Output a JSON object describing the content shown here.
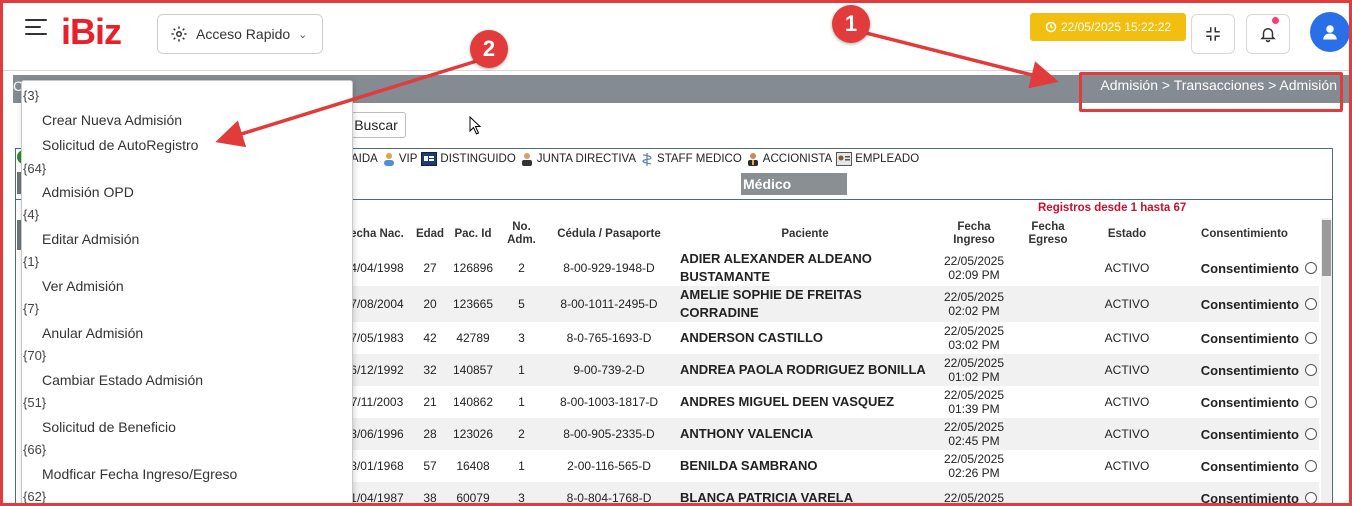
{
  "header": {
    "logo": "iBiz",
    "quick_access_label": "Acceso Rapido",
    "clock": "22/05/2025 15:22:22"
  },
  "breadcrumb": {
    "lead": "C",
    "path": "Admisión > Transacciones > Admisión"
  },
  "search_button": "Buscar",
  "annotations": {
    "badge1": "1",
    "badge2": "2"
  },
  "menu": {
    "entries": [
      {
        "code": "{3}",
        "label": "Crear Nueva Admisión"
      },
      {
        "code": "",
        "label": "Solicitud de AutoRegistro"
      },
      {
        "code": "{64}",
        "label": "Admisión OPD"
      },
      {
        "code": "{4}",
        "label": "Editar Admisión"
      },
      {
        "code": "{1}",
        "label": "Ver Admisión"
      },
      {
        "code": "{7}",
        "label": "Anular Admisión"
      },
      {
        "code": "{70}",
        "label": "Cambiar Estado Admisión"
      },
      {
        "code": "{51}",
        "label": "Solicitud de Beneficio"
      },
      {
        "code": "{66}",
        "label": "Modficar Fecha Ingreso/Egreso"
      },
      {
        "code": "{62}",
        "label": ""
      }
    ]
  },
  "legend": [
    {
      "label": "AIDA",
      "icon": "caida-icon"
    },
    {
      "label": "VIP",
      "icon": "vip-icon"
    },
    {
      "label": "DISTINGUIDO",
      "icon": "distinguished-icon"
    },
    {
      "label": "JUNTA DIRECTIVA",
      "icon": "board-icon"
    },
    {
      "label": "STAFF MEDICO",
      "icon": "caduceus-icon"
    },
    {
      "label": "ACCIONISTA",
      "icon": "shareholder-icon"
    },
    {
      "label": "EMPLEADO",
      "icon": "employee-icon"
    }
  ],
  "section_title": "Médico",
  "records_label": "Registros desde 1 hasta 67",
  "table": {
    "columns": [
      "echa Nac.",
      "Edad",
      "Pac. Id",
      "No. Adm.",
      "Cédula / Pasaporte",
      "Paciente",
      "Fecha Ingreso",
      "Fecha Egreso",
      "Estado",
      "Consentimiento"
    ],
    "rows": [
      {
        "fecha_nac": "4/04/1998",
        "edad": "27",
        "pac_id": "126896",
        "no_adm": "2",
        "cedula": "8-00-929-1948-D",
        "paciente": "ADIER ALEXANDER ALDEANO BUSTAMANTE",
        "ingreso_fecha": "22/05/2025",
        "ingreso_hora": "02:09 PM",
        "egreso": "",
        "estado": "ACTIVO",
        "consent": "Consentimiento"
      },
      {
        "fecha_nac": "7/08/2004",
        "edad": "20",
        "pac_id": "123665",
        "no_adm": "5",
        "cedula": "8-00-1011-2495-D",
        "paciente": "AMELIE SOPHIE DE FREITAS CORRADINE",
        "ingreso_fecha": "22/05/2025",
        "ingreso_hora": "02:02 PM",
        "egreso": "",
        "estado": "ACTIVO",
        "consent": "Consentimiento"
      },
      {
        "fecha_nac": "7/05/1983",
        "edad": "42",
        "pac_id": "42789",
        "no_adm": "3",
        "cedula": "8-0-765-1693-D",
        "paciente": "ANDERSON CASTILLO",
        "ingreso_fecha": "22/05/2025",
        "ingreso_hora": "03:02 PM",
        "egreso": "",
        "estado": "ACTIVO",
        "consent": "Consentimiento"
      },
      {
        "fecha_nac": "6/12/1992",
        "edad": "32",
        "pac_id": "140857",
        "no_adm": "1",
        "cedula": "9-00-739-2-D",
        "paciente": "ANDREA PAOLA RODRIGUEZ BONILLA",
        "ingreso_fecha": "22/05/2025",
        "ingreso_hora": "01:02 PM",
        "egreso": "",
        "estado": "ACTIVO",
        "consent": "Consentimiento"
      },
      {
        "fecha_nac": "7/11/2003",
        "edad": "21",
        "pac_id": "140862",
        "no_adm": "1",
        "cedula": "8-00-1003-1817-D",
        "paciente": "ANDRES MIGUEL DEEN VASQUEZ",
        "ingreso_fecha": "22/05/2025",
        "ingreso_hora": "01:39 PM",
        "egreso": "",
        "estado": "ACTIVO",
        "consent": "Consentimiento"
      },
      {
        "fecha_nac": "3/06/1996",
        "edad": "28",
        "pac_id": "123026",
        "no_adm": "2",
        "cedula": "8-00-905-2335-D",
        "paciente": "ANTHONY VALENCIA",
        "ingreso_fecha": "22/05/2025",
        "ingreso_hora": "02:45 PM",
        "egreso": "",
        "estado": "ACTIVO",
        "consent": "Consentimiento"
      },
      {
        "fecha_nac": "3/01/1968",
        "edad": "57",
        "pac_id": "16408",
        "no_adm": "1",
        "cedula": "2-00-116-565-D",
        "paciente": "BENILDA SAMBRANO",
        "ingreso_fecha": "22/05/2025",
        "ingreso_hora": "02:26 PM",
        "egreso": "",
        "estado": "ACTIVO",
        "consent": "Consentimiento"
      },
      {
        "fecha_nac": "1/04/1987",
        "edad": "38",
        "pac_id": "60079",
        "no_adm": "3",
        "cedula": "8-0-804-1768-D",
        "paciente": "BLANCA PATRICIA VARELA",
        "ingreso_fecha": "22/05/2025",
        "ingreso_hora": "",
        "egreso": "",
        "estado": "",
        "consent": "Consentimiento"
      }
    ]
  },
  "colors": {
    "accent_red": "#e23b3b",
    "logo_red": "#e8202a",
    "clock_yellow": "#f2bf10",
    "avatar_blue": "#2a6fe8",
    "records_red": "#c8102e"
  }
}
